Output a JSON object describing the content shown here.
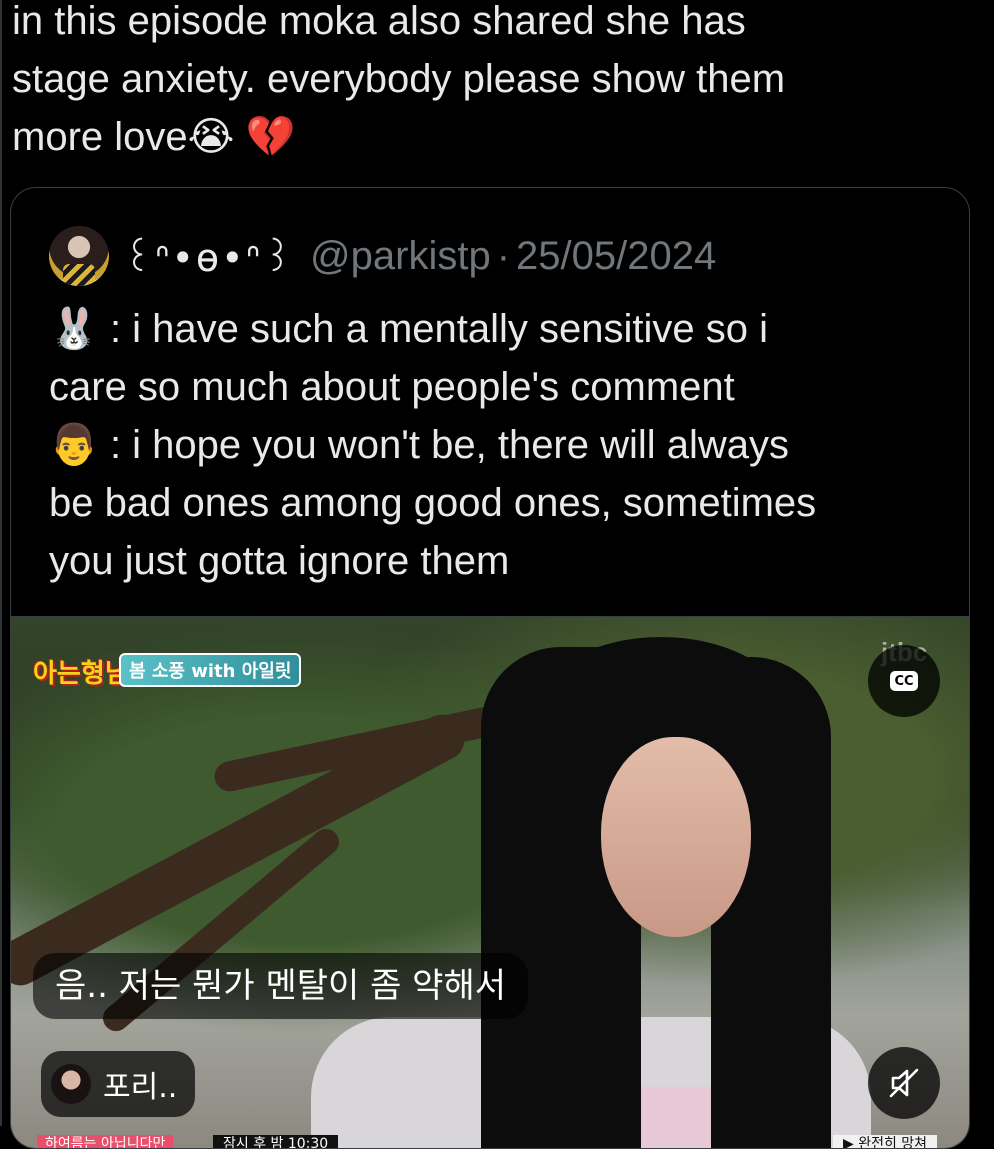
{
  "tweet": {
    "text_line_1": "in this episode moka also shared she has",
    "text_line_2": "stage anxiety. everybody please show them",
    "text_line_3": "more love",
    "emoji_1": "😭",
    "emoji_2": "💔"
  },
  "quoted_tweet": {
    "display_name": "꒰ᐢ•ɵ•ᐢ꒱",
    "handle": "@parkistp",
    "separator": "·",
    "date": "25/05/2024",
    "lines": [
      {
        "emoji": "🐰",
        "text": ": i have such a mentally sensitive so i"
      },
      {
        "emoji": "",
        "text": "care so much about people's comment"
      },
      {
        "emoji": "👨",
        "text": ": i hope you won't be, there will always"
      },
      {
        "emoji": "",
        "text": "be bad ones among good ones, sometimes"
      },
      {
        "emoji": "",
        "text": "you just gotta ignore them"
      }
    ]
  },
  "video": {
    "show_logo": "아는형님",
    "show_tag": "봄 소풍 with 아일릿",
    "channel_watermark": "jtbc",
    "cc_label": "CC",
    "caption": "음.. 저는 뭔가 멘탈이 좀 약해서",
    "speaker_chip": "포리..",
    "banner_left": "하여름는 아닙니다만",
    "banner_middle": "잠시 후 밤 10:30",
    "banner_right": "▶ 완전히 망쳐"
  },
  "icons": {
    "cc": "closed-captions-icon",
    "mute": "volume-muted-icon"
  }
}
